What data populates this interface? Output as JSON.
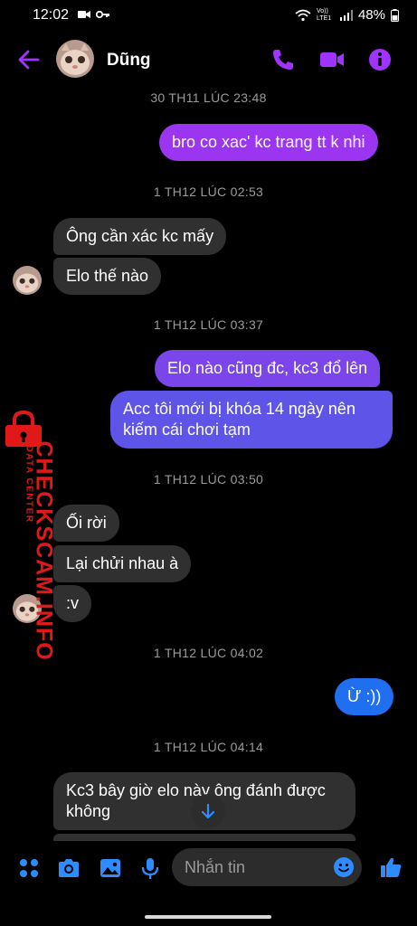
{
  "status_bar": {
    "time": "12:02",
    "network_label": "Vo)) LTE1",
    "battery": "48%"
  },
  "header": {
    "contact_name": "Dũng",
    "accent_color": "#a033ff"
  },
  "timestamps": {
    "t1": "30 TH11 LÚC 23:48",
    "t2": "1 TH12 LÚC 02:53",
    "t3": "1 TH12 LÚC 03:37",
    "t4": "1 TH12 LÚC 03:50",
    "t5": "1 TH12 LÚC 04:02",
    "t6": "1 TH12 LÚC 04:14"
  },
  "messages": {
    "m1": "bro co xac' kc trang tt k nhi",
    "m2": "Ông cần xác kc mấy",
    "m3": "Elo thế nào",
    "m4": "Elo nào cũng đc, kc3 đổ lên",
    "m5": "Acc tôi mới bị khóa 14 ngày nên kiếm cái chơi tạm",
    "m6": "Ối rời",
    "m7": "Lại chửi nhau à",
    "m8": ":v",
    "m9": "Ừ :))",
    "m10": "Kc3 bây giờ elo này ông đánh được không"
  },
  "watermark": {
    "main": "CHECKSCAM.INFO",
    "sub": "DATA CENTER"
  },
  "composer": {
    "placeholder": "Nhắn tin"
  },
  "colors": {
    "outgoing_purple": "#9b35f0",
    "outgoing_blue": "#1f6ff0",
    "incoming": "#303030",
    "composer_blue": "#2d8cff"
  }
}
